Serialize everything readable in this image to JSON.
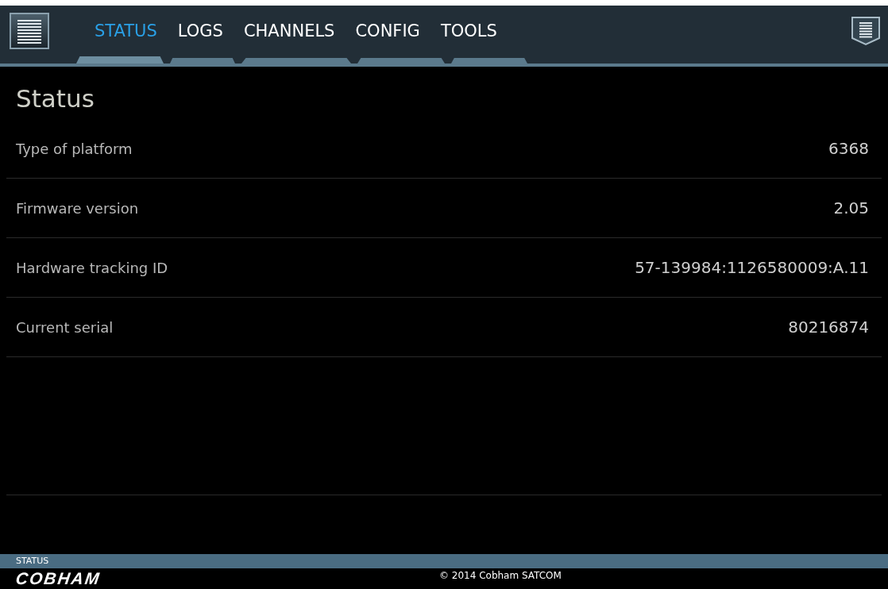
{
  "tabs": [
    {
      "label": "STATUS",
      "selected": true
    },
    {
      "label": "LOGS",
      "selected": false
    },
    {
      "label": "CHANNELS",
      "selected": false
    },
    {
      "label": "CONFIG",
      "selected": false
    },
    {
      "label": "TOOLS",
      "selected": false
    }
  ],
  "page_title": "Status",
  "rows": [
    {
      "label": "Type of platform",
      "value": "6368"
    },
    {
      "label": "Firmware version",
      "value": "2.05"
    },
    {
      "label": "Hardware tracking ID",
      "value": "57-139984:1126580009:A.11"
    },
    {
      "label": "Current serial",
      "value": "80216874"
    }
  ],
  "status_bar": "STATUS",
  "footer": {
    "logo": "COBHAM",
    "copyright": "© 2014 Cobham SATCOM"
  }
}
